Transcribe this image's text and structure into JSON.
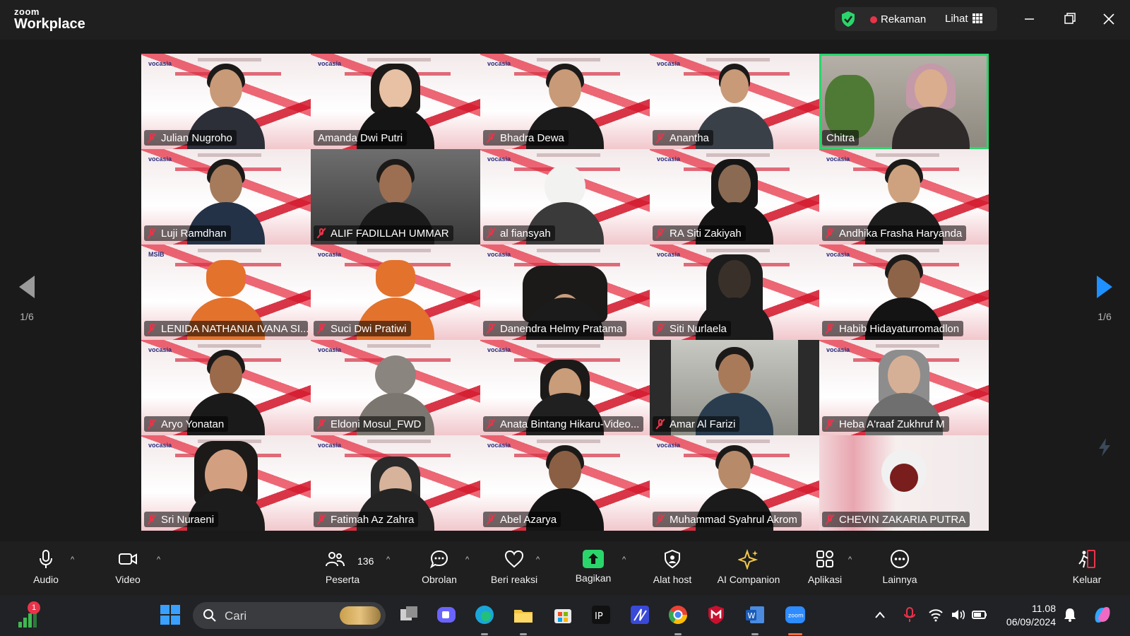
{
  "app": {
    "brand_top": "zoom",
    "brand_main": "Workplace"
  },
  "titlebar": {
    "recording_label": "Rekaman",
    "view_label": "Lihat",
    "recording_color": "#e8344a",
    "security_color": "#2ad66b"
  },
  "pager": {
    "left_text": "1/6",
    "right_text": "1/6"
  },
  "participants": [
    {
      "name": "Julian Nugroho",
      "muted": true
    },
    {
      "name": "Amanda Dwi Putri",
      "muted": false
    },
    {
      "name": "Bhadra Dewa",
      "muted": true
    },
    {
      "name": "Anantha",
      "muted": true
    },
    {
      "name": "Chitra",
      "muted": false,
      "active_speaker": true
    },
    {
      "name": "Luji Ramdhan",
      "muted": true
    },
    {
      "name": "ALIF FADILLAH UMMAR",
      "muted": true
    },
    {
      "name": "al fiansyah",
      "muted": true
    },
    {
      "name": "RA Siti Zakiyah",
      "muted": true
    },
    {
      "name": "Andhika Frasha Haryanda",
      "muted": true
    },
    {
      "name": "LENIDA NATHANIA IVANA SI...",
      "muted": true
    },
    {
      "name": "Suci Dwi Pratiwi",
      "muted": true
    },
    {
      "name": "Danendra Helmy Pratama",
      "muted": true
    },
    {
      "name": "Siti Nurlaela",
      "muted": true
    },
    {
      "name": "Habib Hidayaturromadlon",
      "muted": true
    },
    {
      "name": "Aryo Yonatan",
      "muted": true
    },
    {
      "name": "Eldoni Mosul_FWD",
      "muted": true
    },
    {
      "name": "Anata Bintang Hikaru-Video...",
      "muted": true
    },
    {
      "name": "Amar Al Farizi",
      "muted": true
    },
    {
      "name": "Heba A'raaf Zukhruf M",
      "muted": true
    },
    {
      "name": "Sri Nuraeni",
      "muted": true
    },
    {
      "name": "Fatimah Az Zahra",
      "muted": true
    },
    {
      "name": "Abel Azarya",
      "muted": true
    },
    {
      "name": "Muhammad Syahrul Akrom",
      "muted": true
    },
    {
      "name": "CHEVIN ZAKARIA PUTRA",
      "muted": true
    }
  ],
  "toolbar": {
    "audio": "Audio",
    "video": "Video",
    "participants": "Peserta",
    "participants_count": "136",
    "chat": "Obrolan",
    "react": "Beri reaksi",
    "share": "Bagikan",
    "host_tools": "Alat host",
    "ai_companion": "AI Companion",
    "apps": "Aplikasi",
    "more": "Lainnya",
    "leave": "Keluar",
    "share_color": "#2ad66b"
  },
  "taskbar": {
    "search_placeholder": "Cari",
    "notification_count": "1",
    "time": "11.08",
    "date": "06/09/2024"
  },
  "icons": {
    "title": [
      "shield-icon",
      "record-dot-icon",
      "grid-view-icon",
      "minimize-icon",
      "restore-icon",
      "close-icon"
    ],
    "toolbar": [
      "microphone-icon",
      "camera-icon",
      "participants-icon",
      "chat-icon",
      "heart-icon",
      "share-arrow-icon",
      "host-shield-icon",
      "sparkle-icon",
      "apps-icon",
      "more-icon",
      "leave-icon"
    ]
  }
}
